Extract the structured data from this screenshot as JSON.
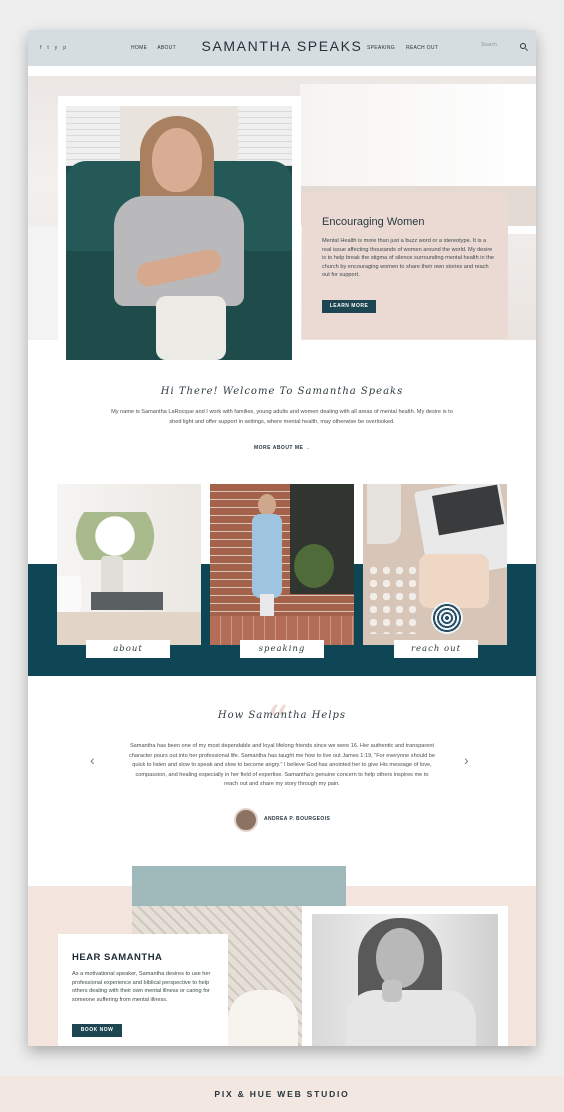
{
  "header": {
    "social": [
      "f",
      "t",
      "y",
      "p"
    ],
    "nav_left": [
      "HOME",
      "ABOUT"
    ],
    "brand": "SAMANTHA SPEAKS",
    "nav_right": [
      "SPEAKING",
      "REACH OUT"
    ],
    "search_placeholder": "Search"
  },
  "hero": {
    "title": "Encouraging Women",
    "body": "Mental Health is more than just a buzz word or a stereotype. It is a real issue affecting thousands of women around the world. My desire is to help break the stigma of silence surrounding mental health in the church by encouraging women to share their own stories and reach out for support.",
    "button": "LEARN MORE"
  },
  "welcome": {
    "title": "Hi There! Welcome To Samantha Speaks",
    "body": "My name is Samantha LaRocque and I work with families, young adults and women dealing with all areas of mental health. My desire is to shed light and offer support in settings, where mental health, may otherwise be overlooked.",
    "link": "MORE ABOUT ME"
  },
  "tiles": [
    "about",
    "speaking",
    "reach out"
  ],
  "testimonial": {
    "title": "How Samantha Helps",
    "quote": "Samantha has been one of my most dependable and loyal lifelong friends since we were 16. Her authentic and transparent character pours out into her professional life. Samantha has taught me how to live out James 1:19, \"For everyone should be quick to listen and slow to speak and slow to become angry.\" I believe God has anointed her to give His message of love, compassion, and healing especially in her field of expertise. Samantha's genuine concern to help others inspires me to reach out and share my story through my pain.",
    "author": "ANDREA P. BOURGEOIS"
  },
  "hear": {
    "title": "HEAR SAMANTHA",
    "body": "As a motivational speaker, Samantha desires to use her professional experience and biblical perspective to help others dealing with their own mental illness or caring for someone suffering from mental illness.",
    "button": "BOOK NOW"
  },
  "footer": {
    "text": "PIX & HUE WEB STUDIO"
  },
  "colors": {
    "header_bg": "#d6dde1",
    "teal": "#0f4655",
    "blush": "#ebdad3",
    "button": "#1d4552"
  }
}
